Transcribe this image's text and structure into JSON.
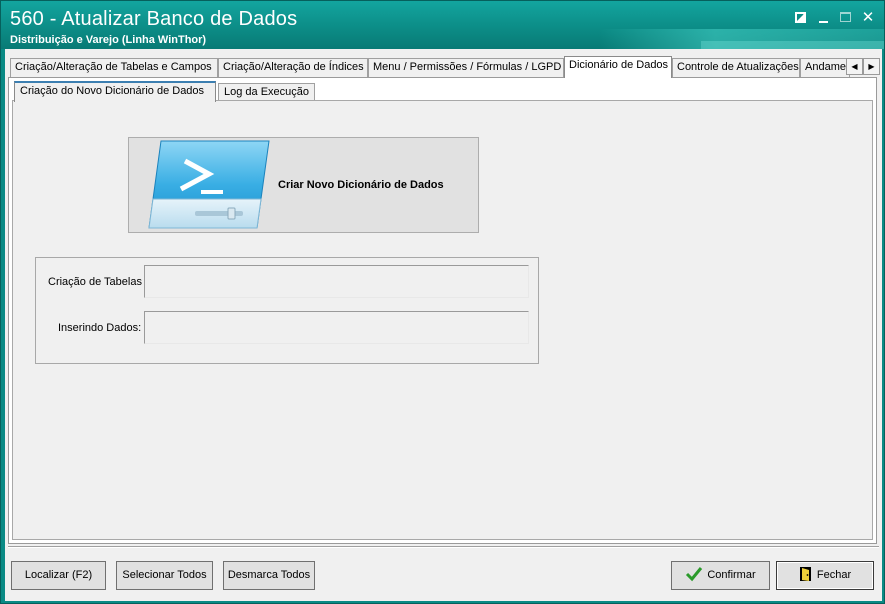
{
  "window": {
    "title": "560 - Atualizar Banco de Dados",
    "subtitle": "Distribuição e Varejo (Linha WinThor)"
  },
  "top_tabs": [
    {
      "label": "Criação/Alteração de Tabelas e Campos"
    },
    {
      "label": "Criação/Alteração de Índices"
    },
    {
      "label": "Menu / Permissões / Fórmulas / LGPD"
    },
    {
      "label": "Dicionário de Dados",
      "active": true
    },
    {
      "label": "Controle de Atualizações"
    },
    {
      "label": "Andame"
    }
  ],
  "sub_tabs": [
    {
      "label": "Criação do Novo Dicionário de Dados",
      "active": true
    },
    {
      "label": "Log da Execução"
    }
  ],
  "main": {
    "create_button_label": "Criar Novo Dicionário de Dados",
    "progress": {
      "tables_label": "Criação de Tabelas",
      "data_label": "Inserindo Dados:"
    }
  },
  "footer": {
    "search_label": "Localizar (F2)",
    "select_all_label": "Selecionar Todos",
    "deselect_all_label": "Desmarca Todos",
    "confirm_label": "Confirmar",
    "close_label": "Fechar"
  },
  "colors": {
    "titlebar": "#0c8d87",
    "face": "#f0f0f0",
    "accent_tab": "#3c7fb1",
    "powershell_blue": "#2ea6e0"
  }
}
